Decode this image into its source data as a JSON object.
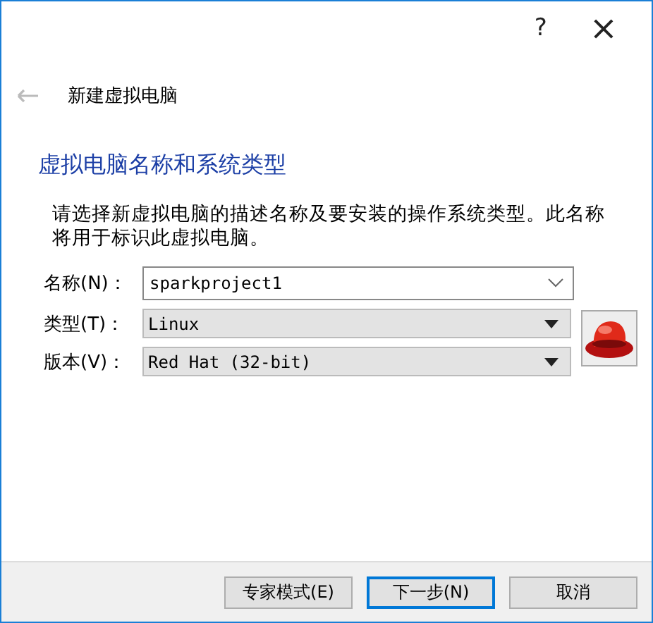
{
  "window": {
    "help": "?",
    "close": "×"
  },
  "header": {
    "title": "新建虚拟电脑"
  },
  "section_title": "虚拟电脑名称和系统类型",
  "description": "请选择新虚拟电脑的描述名称及要安装的操作系统类型。此名称将用于标识此虚拟电脑。",
  "fields": [
    {
      "kind": "combo",
      "label": "名称(N)：",
      "value": "sparkproject1"
    },
    {
      "kind": "select",
      "label": "类型(T)：",
      "value": "Linux"
    },
    {
      "kind": "select",
      "label": "版本(V)：",
      "value": "Red Hat (32-bit)"
    }
  ],
  "buttons": [
    {
      "label": "专家模式(E)",
      "default": false
    },
    {
      "label": "下一步(N)",
      "default": true
    },
    {
      "label": "取消",
      "default": false
    }
  ]
}
